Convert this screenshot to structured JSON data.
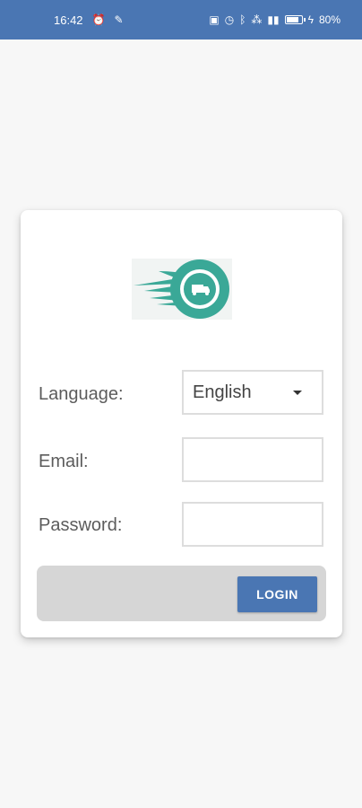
{
  "status_bar": {
    "time": "16:42",
    "battery": "80%",
    "battery_level": 0.8
  },
  "login_form": {
    "language_label": "Language:",
    "language_value": "English",
    "email_label": "Email:",
    "email_value": "",
    "password_label": "Password:",
    "password_value": "",
    "login_button": "LOGIN"
  },
  "colors": {
    "primary": "#4a76b3",
    "logo_teal": "#3aa897"
  }
}
